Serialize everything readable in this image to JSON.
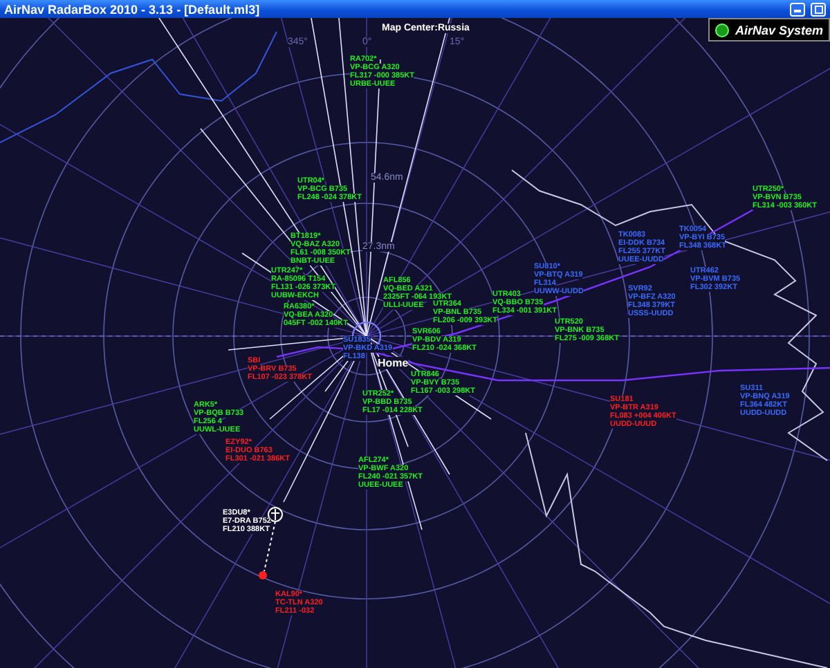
{
  "window": {
    "title": "AirNav RadarBox 2010 - 3.13 - [Default.ml3]"
  },
  "logo": {
    "text": "AirNav System"
  },
  "map": {
    "center_label": "Map Center:Russia",
    "home_label": "Home",
    "range_labels": [
      "54.6nm",
      "27.3nm"
    ],
    "bearing_labels": [
      "345°",
      "0°",
      "15°"
    ]
  },
  "aircraft": [
    {
      "callsign": "RA702*",
      "lines": [
        "VP-BCG A320",
        "FL317 -000 385KT",
        "URBE-UUEE"
      ],
      "color": "#22ee22"
    },
    {
      "callsign": "UTR04*",
      "lines": [
        "VP-BCG B735",
        "FL248 -024 378KT"
      ],
      "color": "#22ee22"
    },
    {
      "callsign": "BT1819*",
      "lines": [
        "VQ-BAZ A320",
        "FL61 -008 350KT",
        "BNBT-UUEE"
      ],
      "color": "#22ee22"
    },
    {
      "callsign": "UTR247*",
      "lines": [
        "RA-85096 T154",
        "FL131 -026 373KT",
        "UUBW-EKCH"
      ],
      "color": "#22ee22"
    },
    {
      "callsign": "RA6380*",
      "lines": [
        "VQ-BEA A320",
        "045FT -002 140KT"
      ],
      "color": "#22ee22"
    },
    {
      "callsign": "AFL856",
      "lines": [
        "VQ-BED A321",
        "2325FT -064 193KT",
        "ULLI-UUEE"
      ],
      "color": "#22ee22"
    },
    {
      "callsign": "UTR364",
      "lines": [
        "VP-BNL B735",
        "FL206 -009 393KT"
      ],
      "color": "#22ee22"
    },
    {
      "callsign": "SVR606",
      "lines": [
        "VP-BDV A319",
        "FL210 -024 368KT"
      ],
      "color": "#22ee22"
    },
    {
      "callsign": "UTR403",
      "lines": [
        "VQ-BBO B735",
        "FL334 -001 391KT"
      ],
      "color": "#22ee22"
    },
    {
      "callsign": "UTR250*",
      "lines": [
        "VP-BVN B735",
        "FL314 -003 360KT"
      ],
      "color": "#22ee22"
    },
    {
      "callsign": "TK0083",
      "lines": [
        "EI-DDK B734",
        "FL255 377KT",
        "UUEE-UUDD"
      ],
      "color": "#3a6bff"
    },
    {
      "callsign": "TK0054",
      "lines": [
        "VP-BYI B735",
        "FL348 368KT"
      ],
      "color": "#3a6bff"
    },
    {
      "callsign": "SU810*",
      "lines": [
        "VP-BTQ A319",
        "FL314",
        "UUWW-UUDD"
      ],
      "color": "#3a6bff"
    },
    {
      "callsign": "UTR462",
      "lines": [
        "VP-BVM B735",
        "FL302 392KT"
      ],
      "color": "#3a6bff"
    },
    {
      "callsign": "SVR92",
      "lines": [
        "VP-BFZ A320",
        "FL348 379KT",
        "USSS-UUDD"
      ],
      "color": "#3a6bff"
    },
    {
      "callsign": "UTR520",
      "lines": [
        "VP-BNK B735",
        "FL275 -009 368KT"
      ],
      "color": "#22ee22"
    },
    {
      "callsign": "SU311",
      "lines": [
        "VP-BNQ A319",
        "FL364 482KT",
        "UUDD-UUDD"
      ],
      "color": "#3a6bff"
    },
    {
      "callsign": "SU181",
      "lines": [
        "VP-BTR A319",
        "FL083 +004 406KT",
        "UUDD-UUUD"
      ],
      "color": "#ff2020"
    },
    {
      "callsign": "UTR846",
      "lines": [
        "VP-BVY B735",
        "FL167 -003 298KT"
      ],
      "color": "#22ee22"
    },
    {
      "callsign": "UTR252*",
      "lines": [
        "VP-BBD B735",
        "FL17 -014 228KT"
      ],
      "color": "#22ee22"
    },
    {
      "callsign": "AFL274*",
      "lines": [
        "VP-BWF A320",
        "FL240 -021 357KT",
        "UUEE-UUEE"
      ],
      "color": "#22ee22"
    },
    {
      "callsign": "SBI",
      "lines": [
        "VP-BRV B735",
        "FL107 -023 378KT"
      ],
      "color": "#ff2020"
    },
    {
      "callsign": "SU1835",
      "lines": [
        "VP-BKD A319",
        "FL138"
      ],
      "color": "#3a6bff"
    },
    {
      "callsign": "ARK5*",
      "lines": [
        "VP-BQB B733",
        "FL256 4",
        "UUWL-UUEE"
      ],
      "color": "#22ee22"
    },
    {
      "callsign": "EZY92*",
      "lines": [
        "EI-DUO B763",
        "FL301 -021 386KT"
      ],
      "color": "#ff2020"
    },
    {
      "callsign": "E3DU8*",
      "lines": [
        "E7-DRA B752",
        "FL210 388KT"
      ],
      "color": "#ffffff"
    },
    {
      "callsign": "KAL90*",
      "lines": [
        "TC-TLN A320",
        "FL211 -032"
      ],
      "color": "#ff2020"
    }
  ]
}
